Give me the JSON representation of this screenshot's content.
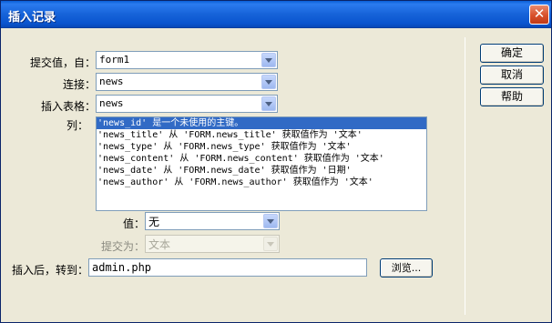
{
  "window": {
    "title": "插入记录",
    "close_glyph": "✕"
  },
  "form": {
    "submit_from_label": "提交值，自：",
    "submit_from_value": "form1",
    "connection_label": "连接：",
    "connection_value": "news",
    "table_label": "插入表格：",
    "table_value": "news",
    "columns_label": "列：",
    "columns": [
      "'news_id' 是一个未使用的主键。",
      "'news_title' 从 'FORM.news_title' 获取值作为 '文本'",
      "'news_type' 从 'FORM.news_type' 获取值作为 '文本'",
      "'news_content' 从 'FORM.news_content' 获取值作为 '文本'",
      "'news_date' 从 'FORM.news_date' 获取值作为 '日期'",
      "'news_author' 从 'FORM.news_author' 获取值作为 '文本'"
    ],
    "selected_column_index": 0,
    "value_label": "值：",
    "value_value": "无",
    "submit_as_label": "提交为：",
    "submit_as_value": "文本",
    "after_insert_label": "插入后，转到：",
    "after_insert_value": "admin.php",
    "browse_label": "浏览..."
  },
  "buttons": {
    "ok": "确定",
    "cancel": "取消",
    "help": "帮助"
  },
  "colors": {
    "titlebar": "#0a5fd8",
    "selection": "#316ac5",
    "dialog_bg": "#ece9d8"
  }
}
